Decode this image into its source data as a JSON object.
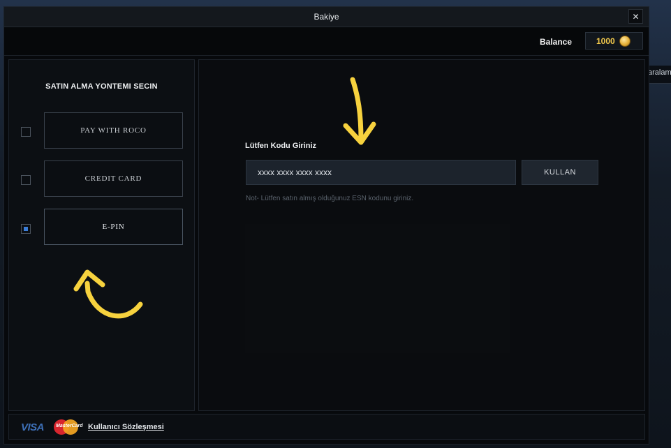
{
  "window": {
    "title": "Bakiye",
    "close_icon": "close-icon"
  },
  "balance": {
    "label": "Balance",
    "value": "1000",
    "icon": "coin-icon"
  },
  "background": {
    "partial_text": "aralam"
  },
  "payment_methods": {
    "heading": "SATIN ALMA YONTEMI SECIN",
    "items": [
      {
        "label": "PAY WITH ROCO",
        "checked": false
      },
      {
        "label": "CREDIT CARD",
        "checked": false
      },
      {
        "label": "E-PIN",
        "checked": true
      }
    ]
  },
  "epin": {
    "label": "Lütfen Kodu Giriniz",
    "input_placeholder": "xxxx xxxx xxxx xxxx",
    "input_value": "",
    "button_label": "KULLAN",
    "note": "Not- Lütfen satın almış olduğunuz ESN kodunu giriniz."
  },
  "footer": {
    "visa_logo": "VISA",
    "mastercard_logo": "MasterCard",
    "terms_link": "Kullanıcı Sözleşmesi"
  },
  "colors": {
    "accent_check": "#3b7dd8",
    "coin_gold": "#f2c94c",
    "annotation_arrow": "#f7d23e"
  }
}
